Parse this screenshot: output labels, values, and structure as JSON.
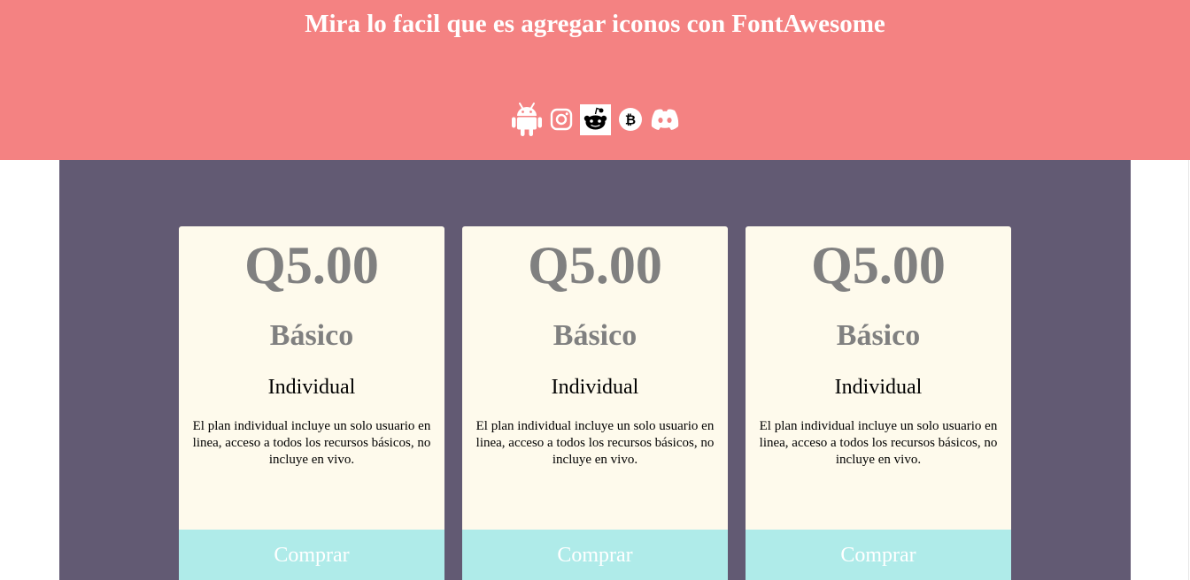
{
  "header": {
    "title": "Mira lo facil que es agregar iconos con FontAwesome",
    "icons": [
      "android-icon",
      "instagram-icon",
      "reddit-icon",
      "bitcoin-icon",
      "discord-icon"
    ]
  },
  "colors": {
    "header_bg": "#f48282",
    "main_bg": "#625a73",
    "card_bg": "#fefaec",
    "button_bg": "#afebe9",
    "muted_text": "#808080"
  },
  "cards": [
    {
      "price": "Q5.00",
      "name": "Básico",
      "type": "Individual",
      "description": "El plan individual incluye un solo usuario en linea, acceso a todos los recursos básicos, no incluye en vivo.",
      "button_label": "Comprar"
    },
    {
      "price": "Q5.00",
      "name": "Básico",
      "type": "Individual",
      "description": "El plan individual incluye un solo usuario en linea, acceso a todos los recursos básicos, no incluye en vivo.",
      "button_label": "Comprar"
    },
    {
      "price": "Q5.00",
      "name": "Básico",
      "type": "Individual",
      "description": "El plan individual incluye un solo usuario en linea, acceso a todos los recursos básicos, no incluye en vivo.",
      "button_label": "Comprar"
    }
  ]
}
